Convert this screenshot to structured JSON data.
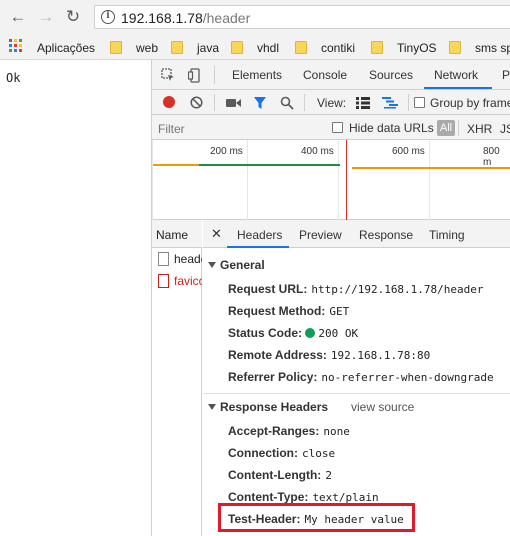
{
  "browser": {
    "url_host": "192.168.1.78",
    "url_path": "/header"
  },
  "bookmarks": [
    {
      "label": "Aplicações"
    },
    {
      "label": "web"
    },
    {
      "label": "java"
    },
    {
      "label": "vhdl"
    },
    {
      "label": "contiki"
    },
    {
      "label": "TinyOS"
    },
    {
      "label": "sms sp"
    }
  ],
  "page": {
    "body_text": "Ok"
  },
  "devtools": {
    "tabs": [
      "Elements",
      "Console",
      "Sources",
      "Network",
      "P"
    ],
    "active_tab": "Network",
    "toolbar": {
      "view_label": "View:",
      "group_by_frame": "Group by frame"
    },
    "filter": {
      "placeholder": "Filter",
      "hide_data_urls": "Hide data URLs",
      "all": "All",
      "xhr": "XHR",
      "js": "JS"
    },
    "timeline_ticks": [
      "200 ms",
      "400 ms",
      "600 ms",
      "800 m"
    ],
    "requests_header": "Name",
    "requests": [
      {
        "name": "header",
        "color": "#222222"
      },
      {
        "name": "favicon.ico",
        "color": "#c5221f"
      }
    ],
    "detail_tabs": [
      "Headers",
      "Preview",
      "Response",
      "Timing"
    ],
    "active_detail_tab": "Headers",
    "general": {
      "title": "General",
      "rows": [
        {
          "key": "Request URL:",
          "value": "http://192.168.1.78/header"
        },
        {
          "key": "Request Method:",
          "value": "GET"
        },
        {
          "key": "Status Code:",
          "value": "200 OK"
        },
        {
          "key": "Remote Address:",
          "value": "192.168.1.78:80"
        },
        {
          "key": "Referrer Policy:",
          "value": "no-referrer-when-downgrade"
        }
      ]
    },
    "response_headers": {
      "title": "Response Headers",
      "view_source": "view source",
      "rows": [
        {
          "key": "Accept-Ranges:",
          "value": "none"
        },
        {
          "key": "Connection:",
          "value": "close"
        },
        {
          "key": "Content-Length:",
          "value": "2"
        },
        {
          "key": "Content-Type:",
          "value": "text/plain"
        },
        {
          "key": "Test-Header:",
          "value": "My header value"
        }
      ]
    }
  },
  "colors": {
    "accent_blue": "#1a73e8",
    "record_red": "#d93025",
    "highlight_red": "#e0192b",
    "status_green": "#0f9d58"
  }
}
